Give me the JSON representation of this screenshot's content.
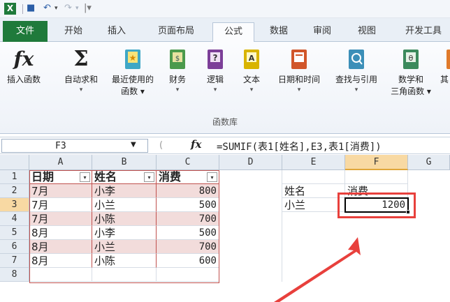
{
  "qat": {
    "logo": "X"
  },
  "tabs": [
    "文件",
    "开始",
    "插入",
    "页面布局",
    "公式",
    "数据",
    "审阅",
    "视图",
    "开发工具"
  ],
  "ribbon": {
    "buttons": [
      {
        "label": "插入函数",
        "label2": "",
        "arrow": ""
      },
      {
        "label": "自动求和",
        "label2": "",
        "arrow": "▾"
      },
      {
        "label": "最近使用的",
        "label2": "函数 ▾",
        "arrow": ""
      },
      {
        "label": "财务",
        "label2": "",
        "arrow": "▾"
      },
      {
        "label": "逻辑",
        "label2": "",
        "arrow": "▾"
      },
      {
        "label": "文本",
        "label2": "",
        "arrow": "▾"
      },
      {
        "label": "日期和时间",
        "label2": "",
        "arrow": "▾"
      },
      {
        "label": "查找与引用",
        "label2": "",
        "arrow": "▾"
      },
      {
        "label": "数学和",
        "label2": "三角函数 ▾",
        "arrow": ""
      },
      {
        "label": "其",
        "label2": "",
        "arrow": ""
      }
    ],
    "group_label": "函数库"
  },
  "formula_bar": {
    "name_box": "F3",
    "fx": "fx",
    "formula": "=SUMIF(表1[姓名],E3,表1[消费])"
  },
  "grid": {
    "columns": [
      "A",
      "B",
      "C",
      "D",
      "E",
      "F",
      "G"
    ],
    "rows": [
      "1",
      "2",
      "3",
      "4",
      "5",
      "6",
      "7",
      "8"
    ],
    "table_headers": [
      "日期",
      "姓名",
      "消费"
    ],
    "table_rows": [
      [
        "7月",
        "小李",
        "800"
      ],
      [
        "7月",
        "小兰",
        "500"
      ],
      [
        "7月",
        "小陈",
        "700"
      ],
      [
        "8月",
        "小李",
        "500"
      ],
      [
        "8月",
        "小兰",
        "700"
      ],
      [
        "8月",
        "小陈",
        "600"
      ]
    ],
    "e2": "姓名",
    "f2": "消费",
    "e3": "小兰",
    "f3": "1200",
    "filter_icon": "▾"
  },
  "colors": {
    "accent": "#1f7a3b",
    "highlight": "#e8403c",
    "table_band": "#f2dcdb"
  }
}
